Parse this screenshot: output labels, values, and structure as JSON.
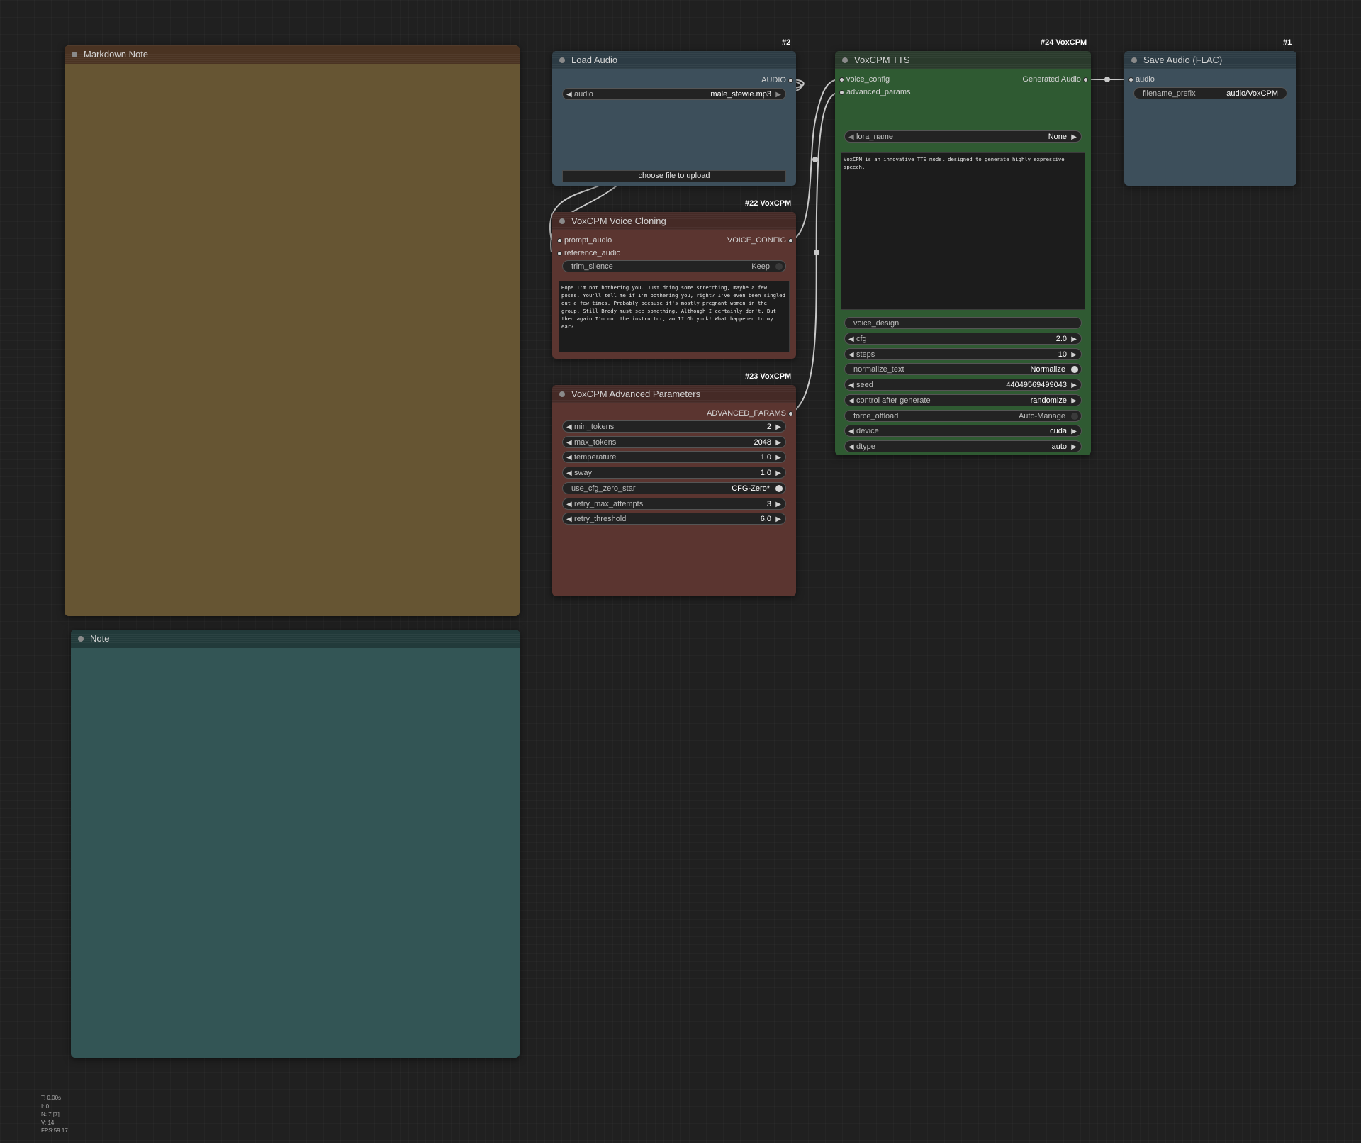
{
  "nodes": {
    "markdown_note": {
      "title": "Markdown Note",
      "color": "#665533"
    },
    "note": {
      "title": "Note",
      "color": "#335555"
    },
    "load_audio": {
      "badge": "#2",
      "title": "Load Audio",
      "output": "AUDIO",
      "audio_label": "audio",
      "audio_value": "male_stewie.mp3",
      "upload_label": "choose file to upload"
    },
    "voice_cloning": {
      "badge": "#22 VoxCPM",
      "title": "VoxCPM Voice Cloning",
      "inputs": [
        "prompt_audio",
        "reference_audio"
      ],
      "output": "VOICE_CONFIG",
      "trim_silence_label": "trim_silence",
      "trim_silence_value": "Keep",
      "text": "Hope I'm not bothering you. Just doing some stretching, maybe a few poses. You'll tell me if I'm bothering you, right? I've even been singled out a few times. Probably because it's mostly pregnant women in the group. Still Brody must see something. Although I certainly don't. But then again I'm not the instructor, am I? Oh yuck! What happened to my ear?"
    },
    "advanced_params": {
      "badge": "#23 VoxCPM",
      "title": "VoxCPM Advanced Parameters",
      "output": "ADVANCED_PARAMS",
      "widgets": [
        {
          "label": "min_tokens",
          "value": "2"
        },
        {
          "label": "max_tokens",
          "value": "2048"
        },
        {
          "label": "temperature",
          "value": "1.0"
        },
        {
          "label": "sway",
          "value": "1.0"
        },
        {
          "label": "use_cfg_zero_star",
          "value": "CFG-Zero*",
          "toggle": true
        },
        {
          "label": "retry_max_attempts",
          "value": "3"
        },
        {
          "label": "retry_threshold",
          "value": "6.0"
        }
      ]
    },
    "tts": {
      "badge": "#24 VoxCPM",
      "title": "VoxCPM TTS",
      "inputs": [
        "voice_config",
        "advanced_params"
      ],
      "output": "Generated Audio",
      "lora_name_label": "lora_name",
      "lora_name_value": "None",
      "text": "VoxCPM is an innovative TTS model designed to generate highly expressive speech.",
      "voice_design_label": "voice_design",
      "widgets": [
        {
          "label": "cfg",
          "value": "2.0"
        },
        {
          "label": "steps",
          "value": "10"
        },
        {
          "label": "normalize_text",
          "value": "Normalize",
          "toggle": true
        },
        {
          "label": "seed",
          "value": "440495694990​43"
        },
        {
          "label": "control after generate",
          "value": "randomize"
        },
        {
          "label": "force_offload",
          "value": "Auto-Manage",
          "toggle": true,
          "off": true
        },
        {
          "label": "device",
          "value": "cuda"
        },
        {
          "label": "dtype",
          "value": "auto"
        }
      ]
    },
    "save_audio": {
      "badge": "#1",
      "title": "Save Audio (FLAC)",
      "input": "audio",
      "filename_prefix_label": "filename_prefix",
      "filename_prefix_value": "audio/VoxCPM"
    }
  },
  "stats": {
    "t": "T: 0.00s",
    "i": "I: 0",
    "n": "N: 7 [7]",
    "v": "V: 14",
    "fps": "FPS:59.17"
  },
  "colors": {
    "canvas": "#202020",
    "load_audio_body": "#3d4f5b",
    "voice_cloning_body": "#5b3530",
    "tts_body": "#2f5a32",
    "save_audio_body": "#3d4f5b",
    "link": "#c8c8c8"
  }
}
